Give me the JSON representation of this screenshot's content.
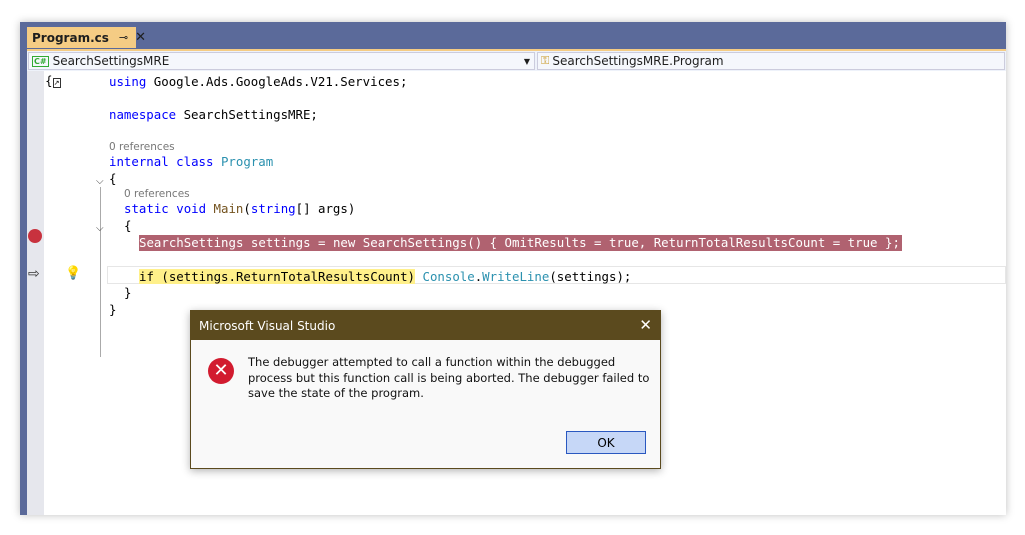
{
  "tab": {
    "title": "Program.cs",
    "pin": "⊸",
    "close": "✕"
  },
  "nav": {
    "project": "SearchSettingsMRE",
    "member": "SearchSettingsMRE.Program"
  },
  "code": {
    "l1": [
      "using",
      " Google.Ads.GoogleAds.V21.Services;"
    ],
    "l2": [
      "namespace",
      " SearchSettingsMRE;"
    ],
    "refs1": "0 references",
    "l3": [
      "internal",
      " ",
      "class",
      " ",
      "Program"
    ],
    "brace_open": "{",
    "refs2": "0 references",
    "l4": [
      "static",
      " ",
      "void",
      " ",
      "Main",
      "(",
      "string",
      "[] args)"
    ],
    "l5": "SearchSettings settings = new SearchSettings() { OmitResults = true, ReturnTotalResultsCount = true };",
    "l6a": "if (settings.ReturnTotalResultsCount)",
    "l6b": [
      "Console",
      ".",
      "WriteLine",
      "(settings);"
    ],
    "brace_close": "}"
  },
  "dialog": {
    "title": "Microsoft Visual Studio",
    "message": "The debugger attempted to call a function within the debugged process but this function call is being aborted. The debugger failed to save the state of the program.",
    "ok": "OK",
    "close": "✕",
    "error_glyph": "✕"
  }
}
